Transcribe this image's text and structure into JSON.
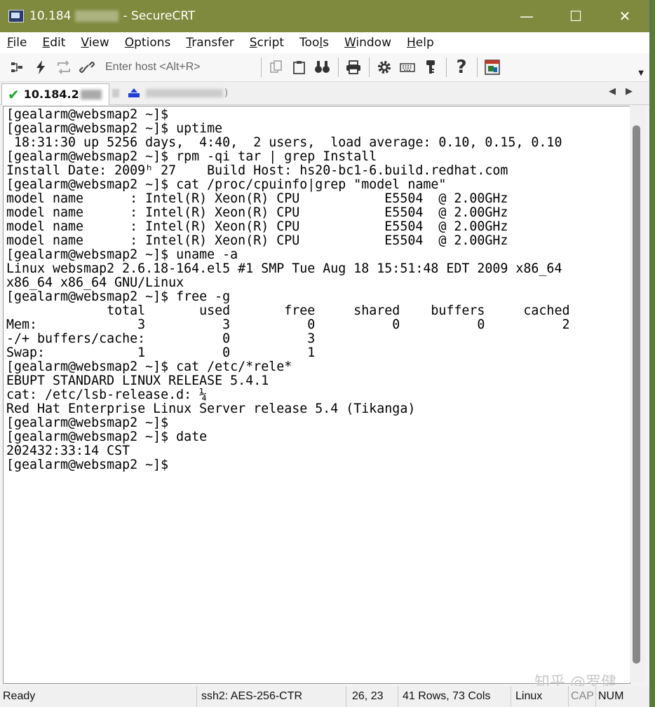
{
  "window": {
    "title_prefix": "10.184",
    "title_suffix": "- SecureCRT",
    "minimize": "—",
    "maximize": "☐",
    "close": "✕"
  },
  "menu": {
    "items": [
      {
        "key": "F",
        "rest": "ile"
      },
      {
        "key": "E",
        "rest": "dit"
      },
      {
        "key": "V",
        "rest": "iew"
      },
      {
        "key": "O",
        "rest": "ptions"
      },
      {
        "key": "T",
        "rest": "ransfer"
      },
      {
        "key": "S",
        "rest": "cript"
      },
      {
        "pre": "Too",
        "key": "l",
        "rest": "s"
      },
      {
        "key": "W",
        "rest": "indow"
      },
      {
        "key": "H",
        "rest": "elp"
      }
    ]
  },
  "toolbar": {
    "host_placeholder": "Enter host <Alt+R>",
    "icons": [
      "connect-icon",
      "quick-connect-icon",
      "reconnect-icon",
      "disconnect-icon",
      "copy-icon",
      "paste-icon",
      "find-icon",
      "print-icon",
      "settings-icon",
      "keymap-icon",
      "key-icon",
      "help-icon",
      "session-manager-icon"
    ]
  },
  "tab": {
    "label": "10.184.2"
  },
  "terminal": {
    "lines": [
      "[gealarm@websmap2 ~]$",
      "[gealarm@websmap2 ~]$ uptime",
      " 18:31:30 up 5256 days,  4:40,  2 users,  load average: 0.10, 0.15, 0.10",
      "[gealarm@websmap2 ~]$ rpm -qi tar | grep Install",
      "Install Date: 2009ʰ 27    Build Host: hs20-bc1-6.build.redhat.com",
      "[gealarm@websmap2 ~]$ cat /proc/cpuinfo|grep \"model name\"",
      "model name      : Intel(R) Xeon(R) CPU           E5504  @ 2.00GHz",
      "model name      : Intel(R) Xeon(R) CPU           E5504  @ 2.00GHz",
      "model name      : Intel(R) Xeon(R) CPU           E5504  @ 2.00GHz",
      "model name      : Intel(R) Xeon(R) CPU           E5504  @ 2.00GHz",
      "[gealarm@websmap2 ~]$ uname -a",
      "Linux websmap2 2.6.18-164.el5 #1 SMP Tue Aug 18 15:51:48 EDT 2009 x86_64",
      "x86_64 x86_64 GNU/Linux",
      "[gealarm@websmap2 ~]$ free -g",
      "             total       used       free     shared    buffers     cached",
      "Mem:             3          3          0          0          0          2",
      "-/+ buffers/cache:          0          3",
      "Swap:            1          0          1",
      "[gealarm@websmap2 ~]$ cat /etc/*rele*",
      "EBUPT STANDARD LINUX RELEASE 5.4.1",
      "cat: /etc/lsb-release.d: ¼",
      "Red Hat Enterprise Linux Server release 5.4 (Tikanga)",
      "[gealarm@websmap2 ~]$",
      "[gealarm@websmap2 ~]$ date",
      "202432:33:14 CST",
      "[gealarm@websmap2 ~]$"
    ]
  },
  "watermark": "知乎 @罗健",
  "status": {
    "ready": "Ready",
    "cipher": "ssh2: AES-256-CTR",
    "cursor": "26,  23",
    "size": "41 Rows, 73 Cols",
    "os": "Linux",
    "cap": "CAP",
    "num": "NUM"
  }
}
